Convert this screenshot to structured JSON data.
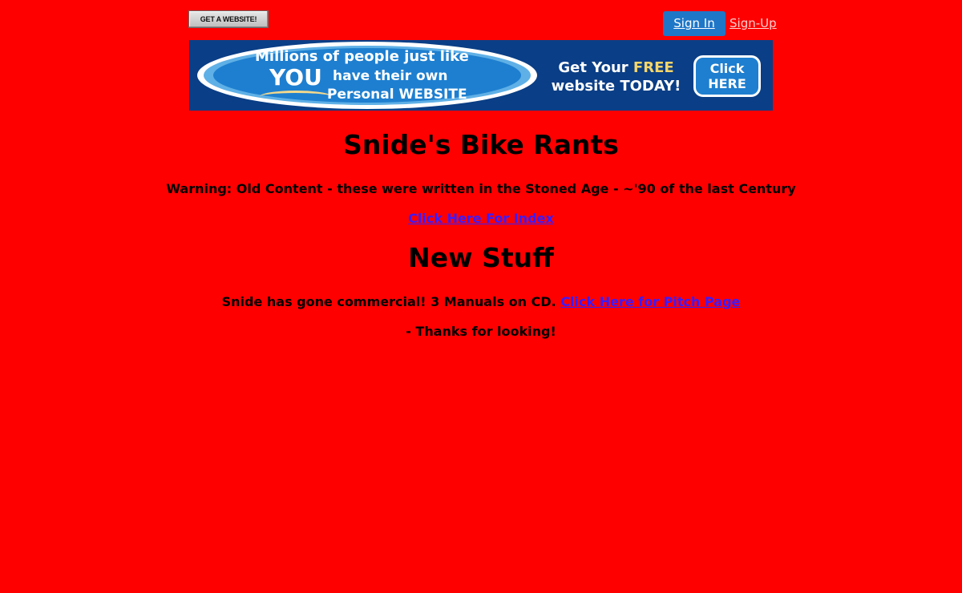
{
  "topbar": {
    "get_website_label": "GET A WEBSITE!",
    "signin_label": "Sign In",
    "signup_label": "Sign-Up"
  },
  "banner": {
    "line1": "Millions of people just like",
    "you": "YOU",
    "line2": "have their own",
    "line3": "Personal WEBSITE",
    "cta_prefix": "Get Your ",
    "cta_free": "FREE",
    "cta_line2": "website TODAY!",
    "click_line1": "Click",
    "click_line2": "HERE",
    "colors": {
      "background": "#0a3e86",
      "oval": "#1e7fd0",
      "highlight": "#f6d66a"
    }
  },
  "page": {
    "title": "Snide's Bike Rants",
    "warning": "Warning: Old Content - these were written in the Stoned Age - ~'90 of the last Century",
    "index_link": "Click Here For Index",
    "new_stuff_heading": "New Stuff",
    "pitch_text": "Snide has gone commercial! 3 Manuals on CD. ",
    "pitch_link": "Click Here for Pitch Page",
    "thanks": "- Thanks for looking!"
  },
  "colors": {
    "page_background": "#ff0000",
    "link": "#3a1cff",
    "signin_button": "#1f77c8"
  }
}
